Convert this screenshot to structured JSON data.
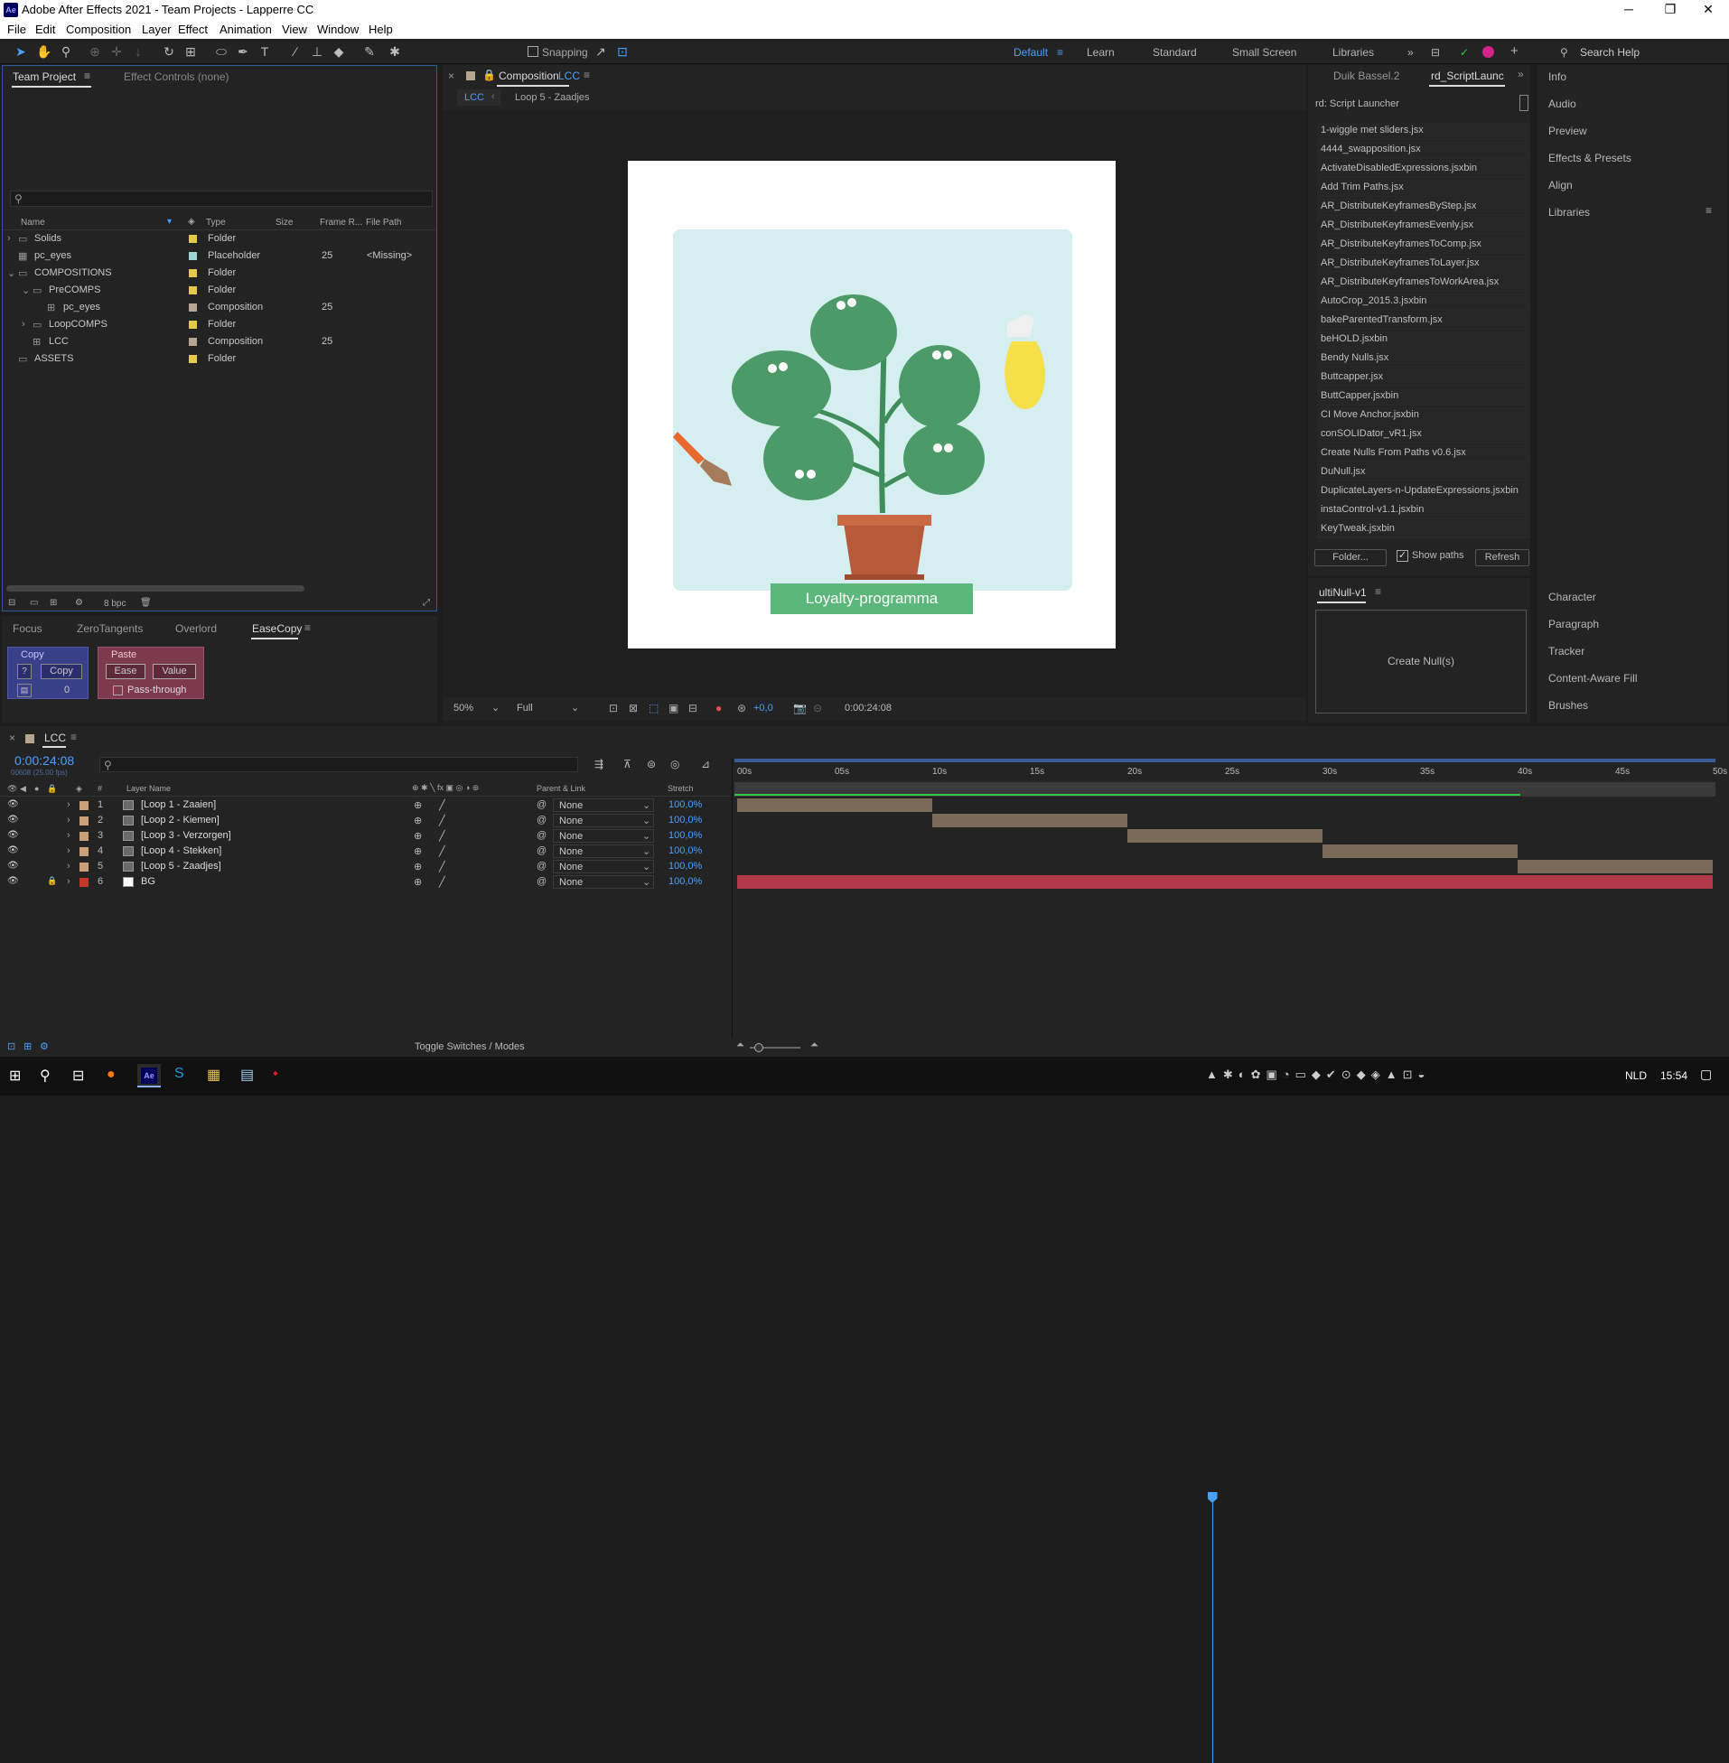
{
  "window": {
    "title": "Adobe After Effects 2021 - Team Projects - Lapperre CC",
    "app_icon": "Ae"
  },
  "menu": [
    "File",
    "Edit",
    "Composition",
    "Layer",
    "Effect",
    "Animation",
    "View",
    "Window",
    "Help"
  ],
  "toolbar": {
    "snapping": "Snapping",
    "workspaces": [
      "Default",
      "Learn",
      "Standard",
      "Small Screen",
      "Libraries"
    ],
    "search_placeholder": "Search Help"
  },
  "project_panel": {
    "tab_active": "Team Project",
    "tab_other": "Effect Controls (none)",
    "columns": [
      "Name",
      "Type",
      "Size",
      "Frame R...",
      "File Path"
    ],
    "rows": [
      {
        "name": "Solids",
        "type": "Folder",
        "fps": "",
        "path": "",
        "color": "#e6c84a"
      },
      {
        "name": "pc_eyes",
        "type": "Placeholder",
        "fps": "25",
        "path": "<Missing>",
        "color": "#9fd4d4"
      },
      {
        "name": "COMPOSITIONS",
        "type": "Folder",
        "fps": "",
        "path": "",
        "color": "#e6c84a"
      },
      {
        "name": "PreCOMPS",
        "type": "Folder",
        "fps": "",
        "path": "",
        "color": "#e6c84a"
      },
      {
        "name": "pc_eyes",
        "type": "Composition",
        "fps": "25",
        "path": "",
        "color": "#b8a58e"
      },
      {
        "name": "LoopCOMPS",
        "type": "Folder",
        "fps": "",
        "path": "",
        "color": "#e6c84a"
      },
      {
        "name": "LCC",
        "type": "Composition",
        "fps": "25",
        "path": "",
        "color": "#b8a58e"
      },
      {
        "name": "ASSETS",
        "type": "Folder",
        "fps": "",
        "path": "",
        "color": "#e6c84a"
      }
    ],
    "bpc": "8 bpc"
  },
  "easecopy_panel": {
    "tabs": [
      "Focus",
      "ZeroTangents",
      "Overlord",
      "EaseCopy"
    ],
    "copy_title": "Copy",
    "copy_q": "?",
    "copy_button": "Copy",
    "copy_count": "0",
    "paste_title": "Paste",
    "ease_button": "Ease",
    "value_button": "Value",
    "passthrough": "Pass-through"
  },
  "composition_panel": {
    "tab_label": "Composition",
    "comp_name": "LCC",
    "breadcrumb_active": "LCC",
    "breadcrumb_next": "Loop 5 - Zaadjes",
    "artwork_label": "Loyalty-programma",
    "zoom": "50%",
    "resolution": "Full",
    "exposure": "+0,0",
    "timecode": "0:00:24:08"
  },
  "script_panel": {
    "tabs": [
      "Duik Bassel.2",
      "rd_ScriptLaunc"
    ],
    "title": "rd: Script Launcher",
    "scripts": [
      "1-wiggle met sliders.jsx",
      "4444_swapposition.jsx",
      "ActivateDisabledExpressions.jsxbin",
      "Add Trim Paths.jsx",
      "AR_DistributeKeyframesByStep.jsx",
      "AR_DistributeKeyframesEvenly.jsx",
      "AR_DistributeKeyframesToComp.jsx",
      "AR_DistributeKeyframesToLayer.jsx",
      "AR_DistributeKeyframesToWorkArea.jsx",
      "AutoCrop_2015.3.jsxbin",
      "bakeParentedTransform.jsx",
      "beHOLD.jsxbin",
      "Bendy Nulls.jsx",
      "Buttcapper.jsx",
      "ButtCapper.jsxbin",
      "CI Move Anchor.jsxbin",
      "conSOLIDator_vR1.jsx",
      "Create Nulls From Paths v0.6.jsx",
      "DuNull.jsx",
      "DuplicateLayers-n-UpdateExpressions.jsxbin",
      "instaControl-v1.1.jsxbin",
      "KeyTweak.jsxbin"
    ],
    "folder_button": "Folder...",
    "show_paths": "Show paths",
    "refresh_button": "Refresh"
  },
  "multinull_panel": {
    "title": "ultiNull-v1",
    "button": "Create Null(s)"
  },
  "right_panels": {
    "top": [
      "Info",
      "Audio",
      "Preview",
      "Effects & Presets",
      "Align",
      "Libraries"
    ],
    "bottom": [
      "Character",
      "Paragraph",
      "Tracker",
      "Content-Aware Fill",
      "Brushes"
    ]
  },
  "timeline": {
    "tab": "LCC",
    "timecode": "0:00:24:08",
    "frame_info": "00608 (25.00 fps)",
    "col_layer_name": "Layer Name",
    "col_parent": "Parent & Link",
    "col_stretch": "Stretch",
    "ruler": [
      "00s",
      "05s",
      "10s",
      "15s",
      "20s",
      "25s",
      "30s",
      "35s",
      "40s",
      "45s",
      "50s"
    ],
    "playhead_seconds": 24.33,
    "duration_seconds": 50,
    "layers": [
      {
        "num": "1",
        "name": "[Loop 1 - Zaaien]",
        "parent": "None",
        "stretch": "100,0%",
        "in": 0,
        "out": 10,
        "color": "#c8a07a"
      },
      {
        "num": "2",
        "name": "[Loop 2 - Kiemen]",
        "parent": "None",
        "stretch": "100,0%",
        "in": 10,
        "out": 20,
        "color": "#c8a07a"
      },
      {
        "num": "3",
        "name": "[Loop 3 - Verzorgen]",
        "parent": "None",
        "stretch": "100,0%",
        "in": 20,
        "out": 30,
        "color": "#c8a07a"
      },
      {
        "num": "4",
        "name": "[Loop 4 - Stekken]",
        "parent": "None",
        "stretch": "100,0%",
        "in": 30,
        "out": 40,
        "color": "#c8a07a"
      },
      {
        "num": "5",
        "name": "[Loop 5 - Zaadjes]",
        "parent": "None",
        "stretch": "100,0%",
        "in": 40,
        "out": 50,
        "color": "#c8a07a"
      },
      {
        "num": "6",
        "name": "BG",
        "parent": "None",
        "stretch": "100,0%",
        "in": 0,
        "out": 50,
        "color": "#c0392b"
      }
    ],
    "toggle_label": "Toggle Switches / Modes"
  },
  "taskbar": {
    "lang": "NLD",
    "time": "15:54"
  }
}
